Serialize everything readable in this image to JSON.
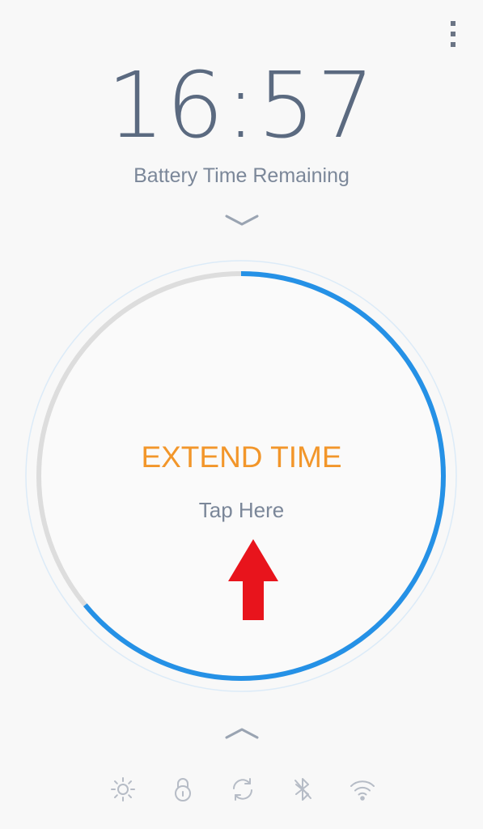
{
  "battery": {
    "time_remaining": "16:57",
    "label": "Battery Time Remaining",
    "charge_fraction": 0.64
  },
  "action": {
    "title": "EXTEND TIME",
    "hint": "Tap Here"
  },
  "icons": {
    "menu": "more-vertical-icon",
    "expand_down": "chevron-down-icon",
    "expand_up": "chevron-up-icon",
    "arrow": "arrow-up-icon",
    "toolbar": [
      "brightness-icon",
      "screen-lock-icon",
      "sync-icon",
      "bluetooth-icon",
      "wifi-icon"
    ]
  },
  "colors": {
    "background": "#f8f8f8",
    "progress": "#2591e6",
    "progress_track": "#dddddd",
    "action_text": "#f2962a",
    "arrow": "#e8141c",
    "text_secondary": "#7b8799",
    "clock_text": "#5b6a80"
  }
}
